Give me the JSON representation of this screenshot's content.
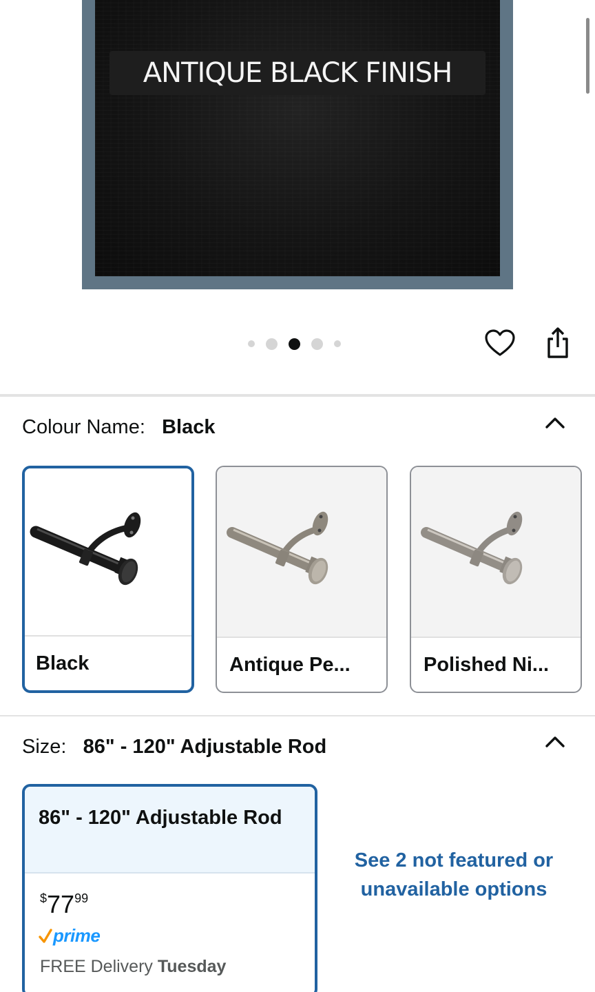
{
  "hero": {
    "banner_text": "ANTIQUE BLACK FINISH"
  },
  "carousel": {
    "active_index": 2,
    "dot_count": 5
  },
  "actions": {
    "wishlist_icon": "heart-icon",
    "share_icon": "share-icon"
  },
  "colour": {
    "label": "Colour Name:",
    "value": "Black",
    "options": [
      {
        "label": "Black",
        "selected": true
      },
      {
        "label": "Antique Pe...",
        "selected": false
      },
      {
        "label": "Polished Ni...",
        "selected": false
      }
    ]
  },
  "size": {
    "label": "Size:",
    "value": "86\" - 120\" Adjustable Rod",
    "option": {
      "title": "86\" - 120\" Adjustable Rod",
      "price_symbol": "$",
      "price_whole": "77",
      "price_fraction": "99",
      "prime_label": "prime",
      "delivery_prefix": "FREE Delivery",
      "delivery_day": "Tuesday"
    },
    "see_more": "See 2 not featured or unavailable options"
  },
  "colors": {
    "accent": "#2162a1",
    "prime_orange": "#f79400",
    "prime_blue": "#1a98ff"
  }
}
